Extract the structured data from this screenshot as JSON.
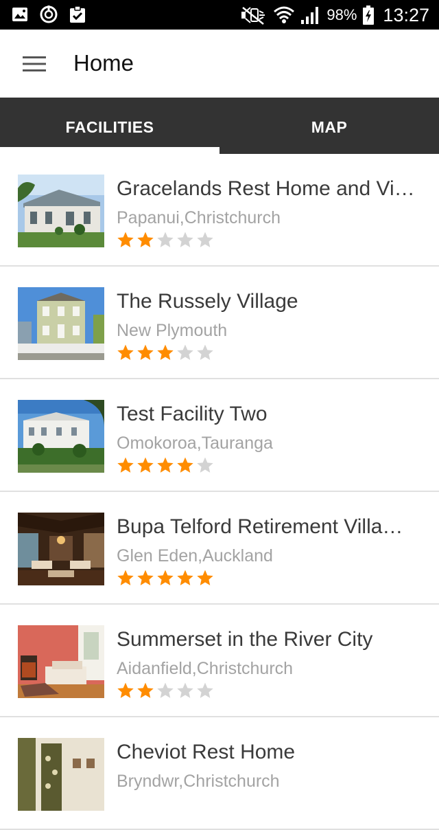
{
  "status_bar": {
    "icons_left": [
      "gallery-icon",
      "power-timer-icon",
      "clipboard-check-icon"
    ],
    "icons_right": [
      "mute-icon",
      "wifi-icon",
      "signal-icon",
      "battery-charging-icon"
    ],
    "battery": "98%",
    "time": "13:27"
  },
  "app_bar": {
    "menu_icon": "hamburger-icon",
    "title": "Home"
  },
  "tabs": [
    {
      "label": "FACILITIES",
      "selected": true
    },
    {
      "label": "MAP",
      "selected": false
    }
  ],
  "colors": {
    "star_filled": "#FF8C00",
    "star_empty": "#D3D3D3",
    "tab_bg": "#333333",
    "name_text": "#3A3A3A",
    "location_text": "#A3A3A3"
  },
  "facilities": [
    {
      "name": "Gracelands Rest Home and Vi…",
      "location": "Papanui,Christchurch",
      "rating": 2,
      "max_rating": 5,
      "thumbnail": "house-photo"
    },
    {
      "name": "The Russely Village",
      "location": "New Plymouth",
      "rating": 3,
      "max_rating": 5,
      "thumbnail": "villa-photo"
    },
    {
      "name": "Test Facility Two",
      "location": "Omokoroa,Tauranga",
      "rating": 4,
      "max_rating": 5,
      "thumbnail": "mansion-photo"
    },
    {
      "name": "Bupa Telford Retirement Villa…",
      "location": "Glen Eden,Auckland",
      "rating": 5,
      "max_rating": 5,
      "thumbnail": "lounge-photo"
    },
    {
      "name": "Summerset in the River City",
      "location": "Aidanfield,Christchurch",
      "rating": 2,
      "max_rating": 5,
      "thumbnail": "bedroom-photo"
    },
    {
      "name": "Cheviot Rest Home",
      "location": "Bryndwr,Christchurch",
      "rating": 0,
      "max_rating": 5,
      "thumbnail": "room-photo"
    }
  ]
}
